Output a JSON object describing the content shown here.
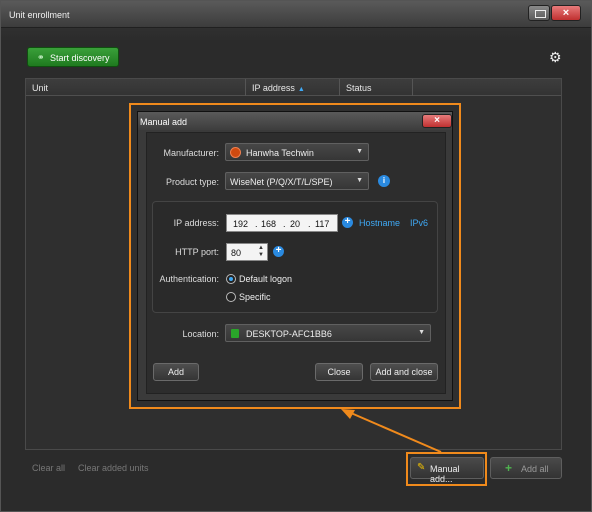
{
  "window": {
    "title": "Unit enrollment",
    "close_glyph": "×"
  },
  "toolbar": {
    "start_discovery_label": "Start discovery",
    "start_discovery_icon": "binoculars-icon",
    "settings_icon": "gear-icon"
  },
  "table": {
    "columns": [
      "Unit",
      "IP address",
      "Status"
    ],
    "sort_indicator": "▲"
  },
  "footer": {
    "clear_all": "Clear all",
    "clear_added_units": "Clear added units",
    "manual_add_label": "Manual add...",
    "add_all_label": "Add all"
  },
  "dialog": {
    "title": "Manual add",
    "close_glyph": "×",
    "manufacturer_label": "Manufacturer:",
    "manufacturer_value": "Hanwha Techwin",
    "product_type_label": "Product type:",
    "product_type_value": "WiseNet (P/Q/X/T/L/SPE)",
    "ip_label": "IP address:",
    "ip_octets": [
      "192",
      "168",
      "20",
      "117"
    ],
    "hostname_link": "Hostname",
    "ipv6_link": "IPv6",
    "http_port_label": "HTTP port:",
    "http_port_value": "80",
    "auth_label": "Authentication:",
    "auth_options": [
      "Default logon",
      "Specific"
    ],
    "auth_selected": "Default logon",
    "location_label": "Location:",
    "location_value": "DESKTOP-AFC1BB6",
    "add_button": "Add",
    "close_button": "Close",
    "add_close_button": "Add and close"
  },
  "colors": {
    "highlight": "#f08a1c",
    "accent_blue": "#3fa9f5",
    "start_green": "#2a8f2a"
  }
}
